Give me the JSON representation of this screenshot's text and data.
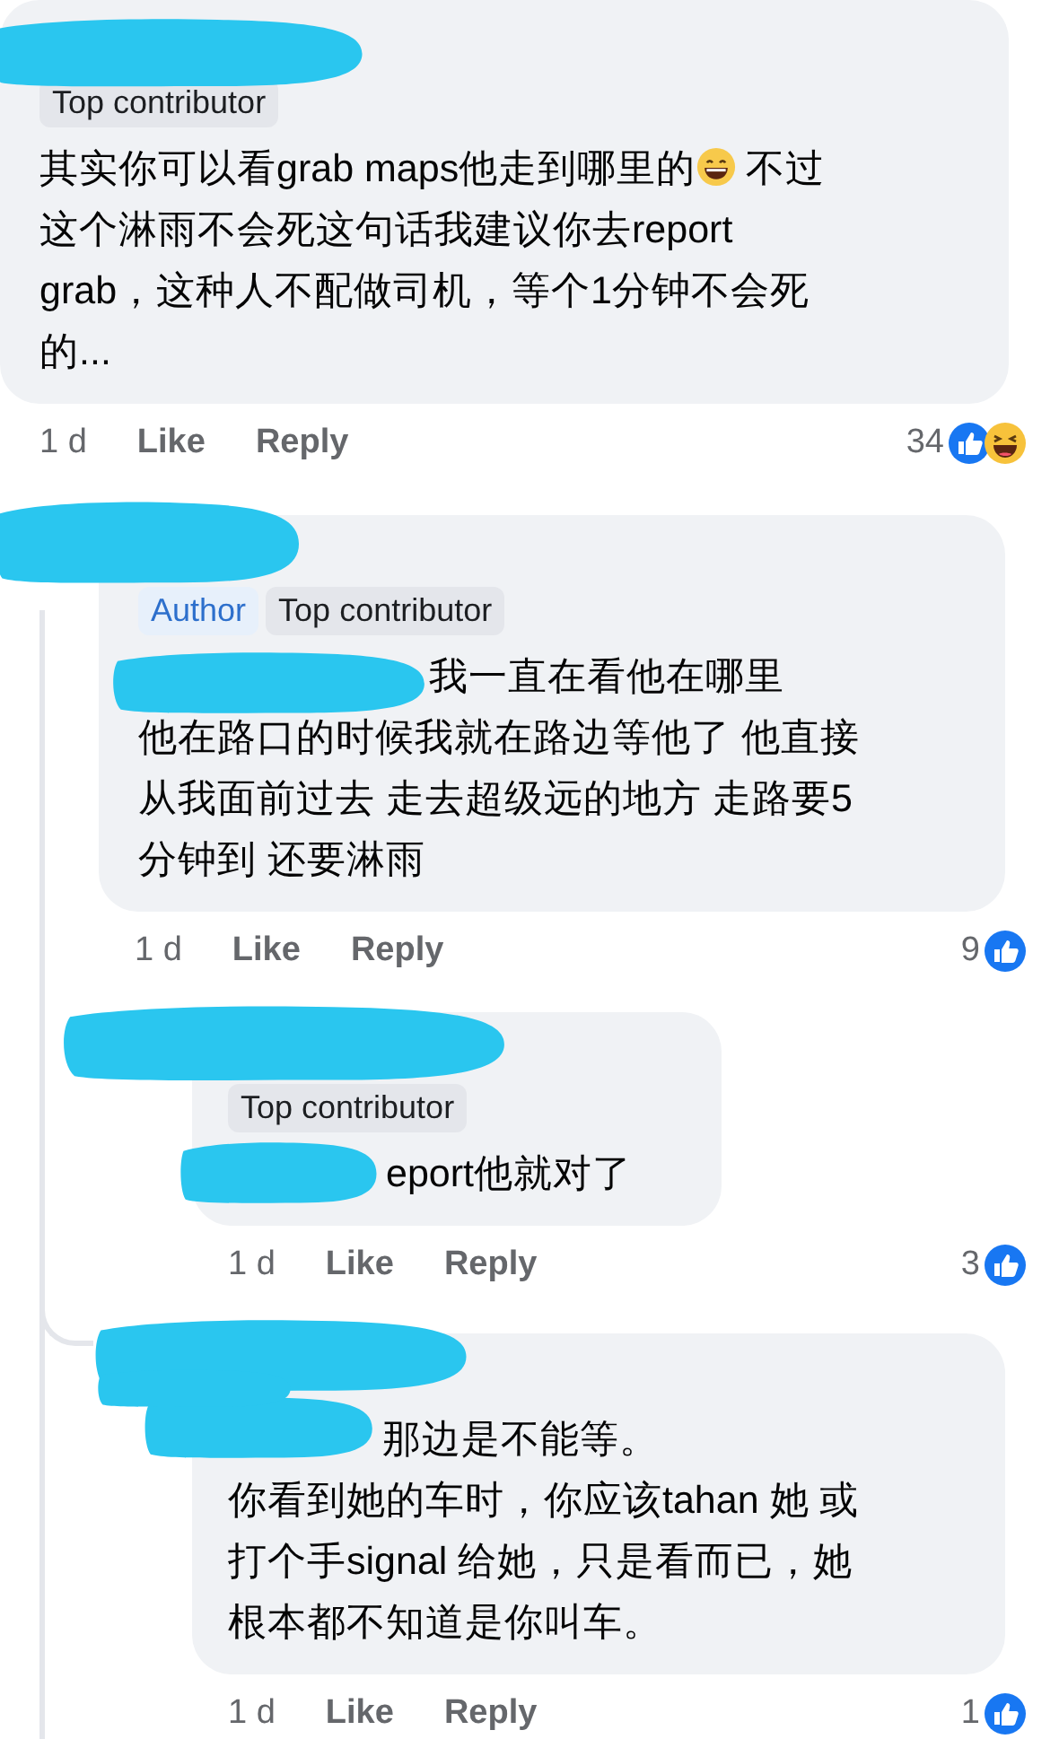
{
  "comments": [
    {
      "name_redacted": true,
      "badges": [
        {
          "kind": "contributor",
          "text": "Top contributor"
        }
      ],
      "lines": [
        [
          {
            "kind": "text",
            "text": "其实你可以看grab maps他走到哪里的"
          },
          {
            "kind": "emoji"
          },
          {
            "kind": "text",
            "text": " 不过"
          }
        ],
        "这个淋雨不会死这句话我建议你去report",
        "grab，这种人不配做司机，等个1分钟不会死",
        "的..."
      ],
      "time": "1 d",
      "like": "Like",
      "reply": "Reply",
      "reaction_count": "34",
      "reactions": [
        {
          "kind": "like"
        },
        {
          "kind": "haha"
        }
      ]
    },
    {
      "name_redacted": true,
      "text_redacted": true,
      "badges": [
        {
          "kind": "author",
          "text": "Author"
        },
        {
          "kind": "contributor",
          "text": "Top contributor"
        }
      ],
      "lines": [
        "我一直在看他在哪里",
        "他在路口的时候我就在路边等他了 他直接",
        "从我面前过去 走去超级远的地方 走路要5",
        "分钟到 还要淋雨"
      ],
      "time": "1 d",
      "like": "Like",
      "reply": "Reply",
      "reaction_count": "9",
      "reactions": [
        {
          "kind": "like"
        }
      ]
    },
    {
      "name_redacted": true,
      "text_redacted": true,
      "badges": [
        {
          "kind": "contributor",
          "text": "Top contributor"
        }
      ],
      "lines": [
        "eport他就对了"
      ],
      "time": "1 d",
      "like": "Like",
      "reply": "Reply",
      "reaction_count": "3",
      "reactions": [
        {
          "kind": "like"
        }
      ]
    },
    {
      "name_redacted": true,
      "text_redacted": true,
      "lines": [
        "那边是不能等。",
        "你看到她的车时，你应该tahan 她 或",
        "打个手signal 给她，只是看而已，她",
        "根本都不知道是你叫车。"
      ],
      "time": "1 d",
      "like": "Like",
      "reply": "Reply",
      "reaction_count": "1",
      "reactions": [
        {
          "kind": "like"
        }
      ]
    }
  ]
}
